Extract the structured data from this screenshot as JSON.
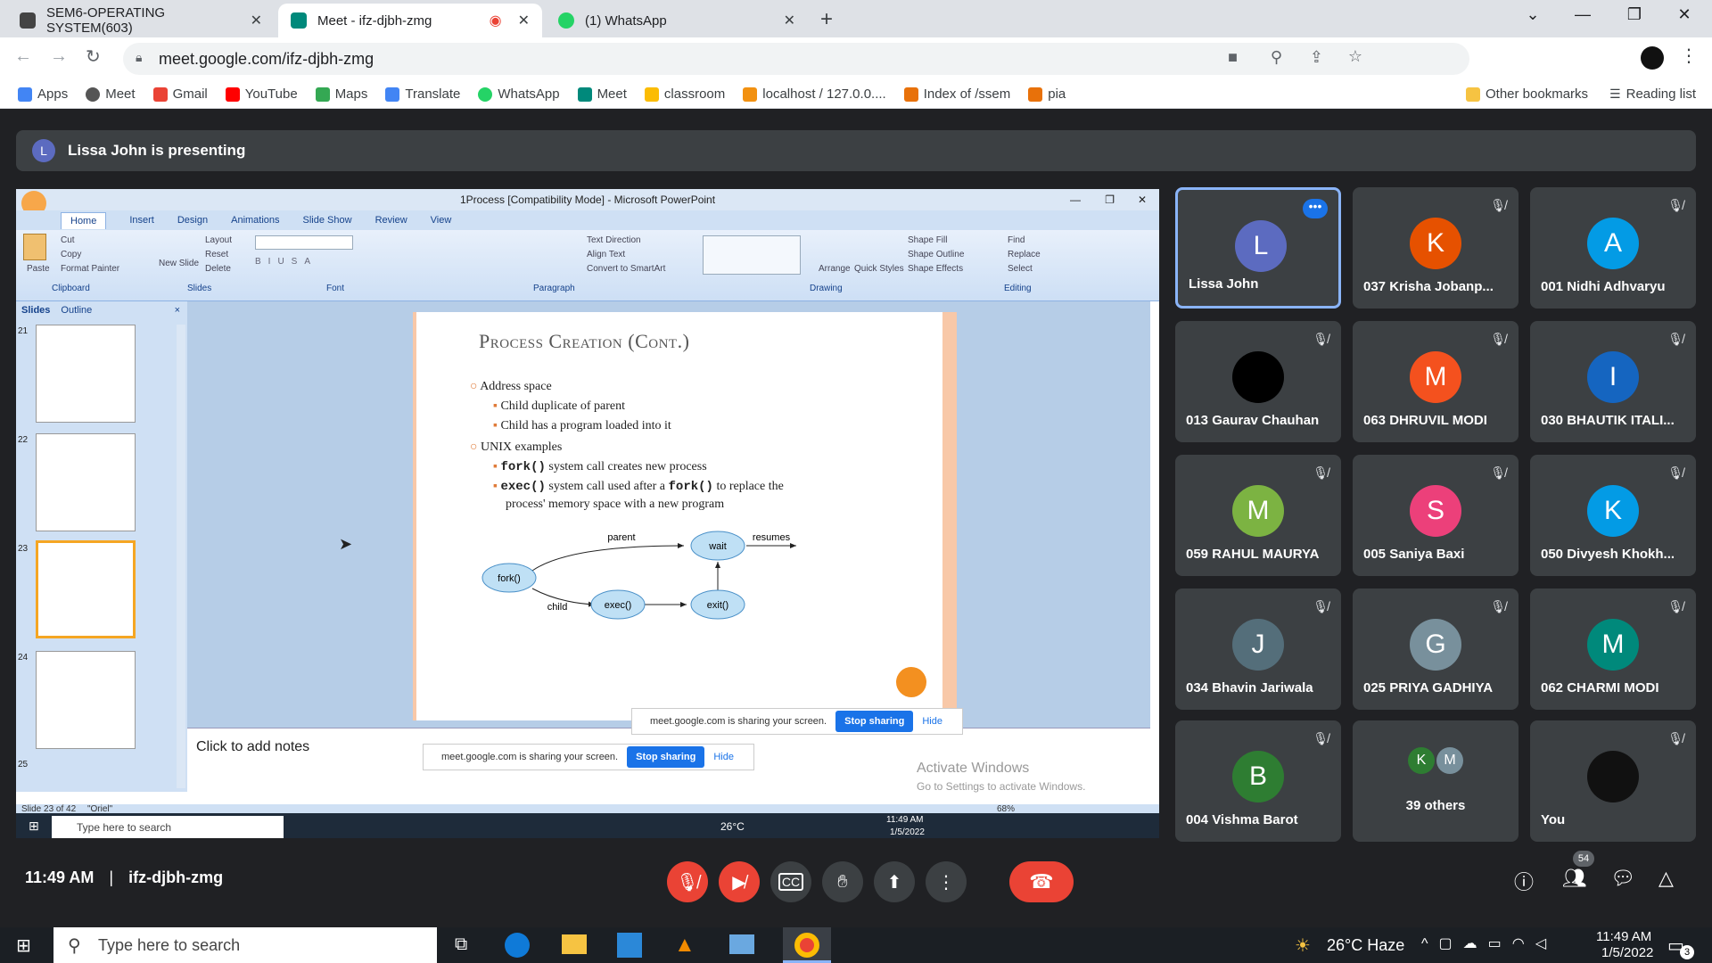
{
  "browser": {
    "tabs": [
      {
        "title": "SEM6-OPERATING SYSTEM(603)",
        "color": "#444444"
      },
      {
        "title": "Meet - ifz-djbh-zmg",
        "color": "#00897b"
      },
      {
        "title": "(1) WhatsApp",
        "color": "#25d366"
      }
    ],
    "url": "meet.google.com/ifz-djbh-zmg",
    "bookmarks": [
      {
        "label": "Apps",
        "color": "#4285f4"
      },
      {
        "label": "Meet",
        "color": "#00897b"
      },
      {
        "label": "Gmail",
        "color": "#ea4335"
      },
      {
        "label": "YouTube",
        "color": "#ff0000"
      },
      {
        "label": "Maps",
        "color": "#34a853"
      },
      {
        "label": "Translate",
        "color": "#4285f4"
      },
      {
        "label": "WhatsApp",
        "color": "#25d366"
      },
      {
        "label": "Meet",
        "color": "#00897b"
      },
      {
        "label": "classroom",
        "color": "#fbbc04"
      },
      {
        "label": "localhost / 127.0.0....",
        "color": "#f29111"
      },
      {
        "label": "Index of /ssem",
        "color": "#e8710a"
      },
      {
        "label": "pia",
        "color": "#e8710a"
      }
    ],
    "other_bookmarks": "Other bookmarks",
    "reading_list": "Reading list"
  },
  "meet": {
    "presenter_initial": "L",
    "presenting_text": "Lissa John is presenting",
    "time": "11:49 AM",
    "separator": "|",
    "meeting_code": "ifz-djbh-zmg",
    "participant_count": "54",
    "tiles": [
      {
        "name": "Lissa John",
        "initial": "L",
        "color": "#5c6bc0",
        "speaking": true
      },
      {
        "name": "037 Krisha Jobanp...",
        "initial": "K",
        "color": "#e65100"
      },
      {
        "name": "001 Nidhi Adhvaryu",
        "initial": "A",
        "color": "#039be5"
      },
      {
        "name": "013 Gaurav Chauhan",
        "initial": "",
        "color": "#000000"
      },
      {
        "name": "063 DHRUVIL MODI",
        "initial": "M",
        "color": "#f4511e"
      },
      {
        "name": "030 BHAUTIK ITALI...",
        "initial": "I",
        "color": "#1565c0"
      },
      {
        "name": "059 RAHUL MAURYA",
        "initial": "M",
        "color": "#7cb342"
      },
      {
        "name": "005 Saniya Baxi",
        "initial": "S",
        "color": "#ec407a"
      },
      {
        "name": "050 Divyesh Khokh...",
        "initial": "K",
        "color": "#039be5"
      },
      {
        "name": "034 Bhavin Jariwala",
        "initial": "J",
        "color": "#546e7a"
      },
      {
        "name": "025 PRIYA GADHIYA",
        "initial": "G",
        "color": "#78909c"
      },
      {
        "name": "062 CHARMI MODI",
        "initial": "M",
        "color": "#00897b"
      },
      {
        "name": "004 Vishma Barot",
        "initial": "B",
        "color": "#2e7d32"
      },
      {
        "name": "39 others",
        "initial": "",
        "color": "#3c4043"
      },
      {
        "name": "You",
        "initial": "",
        "color": "#111111"
      }
    ],
    "others_initials": [
      "K",
      "M"
    ]
  },
  "ppt": {
    "window_title": "1Process [Compatibility Mode] - Microsoft PowerPoint",
    "tabs": [
      "Home",
      "Insert",
      "Design",
      "Animations",
      "Slide Show",
      "Review",
      "View"
    ],
    "groups": [
      "Clipboard",
      "Slides",
      "Font",
      "Paragraph",
      "Drawing",
      "Editing"
    ],
    "clipboard": {
      "paste": "Paste",
      "cut": "Cut",
      "copy": "Copy",
      "format": "Format Painter"
    },
    "slides_grp": {
      "new": "New Slide",
      "layout": "Layout",
      "reset": "Reset",
      "delete": "Delete"
    },
    "para": {
      "dir": "Text Direction",
      "align": "Align Text",
      "smart": "Convert to SmartArt"
    },
    "drawing": {
      "arrange": "Arrange",
      "quick": "Quick Styles",
      "fill": "Shape Fill",
      "outline": "Shape Outline",
      "effects": "Shape Effects"
    },
    "editing": {
      "find": "Find",
      "replace": "Replace",
      "select": "Select"
    },
    "pane_tabs": [
      "Slides",
      "Outline"
    ],
    "thumb_numbers": [
      "21",
      "22",
      "23",
      "24",
      "25"
    ],
    "slide": {
      "title": "Process Creation (Cont.)",
      "b1": "Address space",
      "b1a": "Child duplicate of parent",
      "b1b": "Child has a program loaded into it",
      "b2": "UNIX examples",
      "b2a_code": "fork()",
      "b2a_text": " system call creates new process",
      "b2b_code": "exec()",
      "b2b_text1": " system call used after a ",
      "b2b_code2": "fork()",
      "b2b_text2": " to replace the",
      "b2b_line2": "process' memory space with a new program",
      "diagram": {
        "fork": "fork()",
        "wait": "wait",
        "exec": "exec()",
        "exit": "exit()",
        "parent": "parent",
        "child": "child",
        "resumes": "resumes"
      }
    },
    "notes": "Click to add notes",
    "status_slide": "Slide 23 of 42",
    "status_theme": "\"Oriel\"",
    "zoom": "68%",
    "share_text": "meet.google.com is sharing your screen.",
    "stop_sharing": "Stop sharing",
    "hide": "Hide",
    "activate1": "Activate Windows",
    "activate2": "Go to Settings to activate Windows.",
    "inner_search": "Type here to search",
    "inner_weather": "26°C",
    "inner_time": "11:49 AM",
    "inner_date": "1/5/2022"
  },
  "taskbar": {
    "search": "Type here to search",
    "weather": "26°C Haze",
    "time": "11:49 AM",
    "date": "1/5/2022",
    "notif": "3"
  }
}
